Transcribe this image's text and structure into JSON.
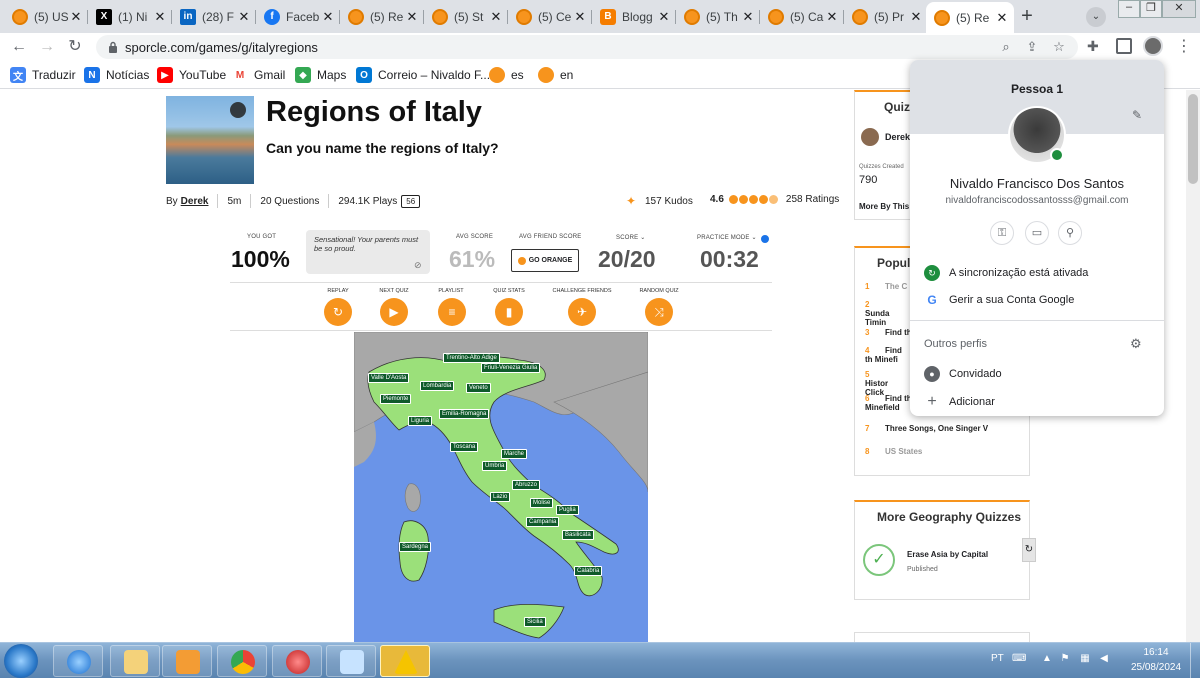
{
  "tabs": [
    {
      "title": "(5) US",
      "icon": "sporcle"
    },
    {
      "title": "(1) Ni",
      "icon": "x"
    },
    {
      "title": "(28) F",
      "icon": "linkedin"
    },
    {
      "title": "Faceb",
      "icon": "facebook"
    },
    {
      "title": "(5) Re",
      "icon": "sporcle"
    },
    {
      "title": "(5) St",
      "icon": "sporcle"
    },
    {
      "title": "(5) Ce",
      "icon": "sporcle"
    },
    {
      "title": "Blogg",
      "icon": "blogger"
    },
    {
      "title": "(5) Th",
      "icon": "sporcle"
    },
    {
      "title": "(5) Ca",
      "icon": "sporcle"
    },
    {
      "title": "(5) Pr",
      "icon": "sporcle"
    },
    {
      "title": "(5) Re",
      "icon": "sporcle",
      "active": true
    }
  ],
  "toolbar": {
    "url": "sporcle.com/games/g/italyregions"
  },
  "bookmarks": [
    {
      "label": "Traduzir",
      "icon": "translate"
    },
    {
      "label": "Notícias",
      "icon": "news"
    },
    {
      "label": "YouTube",
      "icon": "youtube"
    },
    {
      "label": "Gmail",
      "icon": "gmail"
    },
    {
      "label": "Maps",
      "icon": "maps"
    },
    {
      "label": "Correio – Nivaldo F...",
      "icon": "outlook"
    },
    {
      "label": "es",
      "icon": "sporcle"
    },
    {
      "label": "en",
      "icon": "sporcle"
    }
  ],
  "quiz": {
    "title": "Regions of Italy",
    "subtitle": "Can you name the regions of Italy?",
    "by": "By",
    "author": "Derek",
    "duration": "5m",
    "questions": "20 Questions",
    "plays": "294.1K Plays",
    "comments": "56",
    "kudos": "157 Kudos",
    "rating": "4.6",
    "ratings": "258 Ratings"
  },
  "stats": {
    "you_got_label": "YOU GOT",
    "you_got": "100%",
    "message": "Sensational! Your parents must be so proud.",
    "avg_score_label": "AVG SCORE",
    "avg_score": "61%",
    "avg_friend_label": "AVG FRIEND SCORE",
    "go_orange": "GO ORANGE",
    "score_label": "SCORE",
    "score": "20/20",
    "practice_label": "PRACTICE MODE",
    "timer": "00:32"
  },
  "actions": [
    {
      "label": "REPLAY",
      "icon": "replay-icon"
    },
    {
      "label": "NEXT QUIZ",
      "icon": "next-icon"
    },
    {
      "label": "PLAYLIST",
      "icon": "playlist-icon"
    },
    {
      "label": "QUIZ STATS",
      "icon": "stats-icon"
    },
    {
      "label": "CHALLENGE FRIENDS",
      "icon": "challenge-icon"
    },
    {
      "label": "RANDOM QUIZ",
      "icon": "random-icon"
    }
  ],
  "regions": [
    "Trentino-Alto Adige",
    "Friuli-Venezia Giulia",
    "Valle D'Aosta",
    "Lombardia",
    "Veneto",
    "Piemonte",
    "Emilia-Romagna",
    "Liguria",
    "Toscana",
    "Marche",
    "Umbria",
    "Abruzzo",
    "Lazio",
    "Molise",
    "Puglia",
    "Campania",
    "Basilicata",
    "Sardegna",
    "Calabria",
    "Sicilia"
  ],
  "sidebar": {
    "quiz_box_title": "Quiz",
    "author": "Derek",
    "quizzes_created_label": "Quizzes Created",
    "quizzes_created": "790",
    "more_by": "More By This",
    "popular_title": "Popul",
    "popular": [
      {
        "n": "1",
        "text": "The C"
      },
      {
        "n": "2",
        "text": "Sunda Timin"
      },
      {
        "n": "3",
        "text": "Find th"
      },
      {
        "n": "4",
        "text": "Find th Minefi"
      },
      {
        "n": "5",
        "text": "Histor Click"
      },
      {
        "n": "6",
        "text": "Find th Outlines Minefield"
      },
      {
        "n": "7",
        "text": "Three Songs, One Singer V"
      },
      {
        "n": "8",
        "text": "US States"
      }
    ],
    "more_geo_title": "More Geography Quizzes",
    "geo_item": "Erase Asia by Capital",
    "geo_item_status": "Published"
  },
  "profile_popup": {
    "person": "Pessoa 1",
    "name": "Nivaldo Francisco Dos Santos",
    "email": "nivaldofranciscodossantosss@gmail.com",
    "sync": "A sincronização está ativada",
    "manage": "Gerir a sua Conta Google",
    "other_profiles": "Outros perfis",
    "guest": "Convidado",
    "add": "Adicionar"
  },
  "taskbar": {
    "lang": "PT",
    "time": "16:14",
    "date": "25/08/2024"
  }
}
